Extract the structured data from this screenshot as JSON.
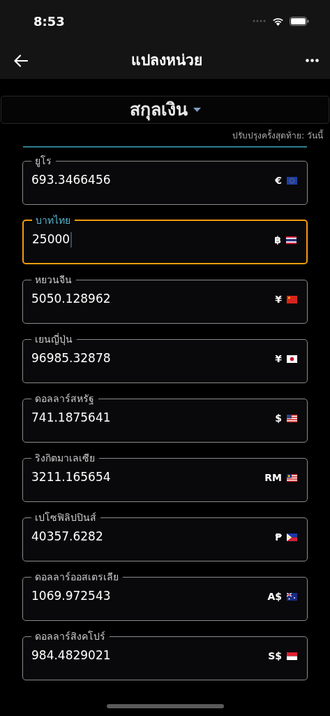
{
  "status_bar": {
    "time": "8:53"
  },
  "nav": {
    "title": "แปลงหน่วย"
  },
  "category": {
    "label": "สกุลเงิน"
  },
  "updated": "ปรับปรุงครั้งสุดท้าย: วันนี้",
  "fields": [
    {
      "label": "ยูโร",
      "value": "693.3466456",
      "symbol": "€",
      "focused": false
    },
    {
      "label": "บาทไทย",
      "value": "25000",
      "symbol": "฿",
      "focused": true
    },
    {
      "label": "หยวนจีน",
      "value": "5050.128962",
      "symbol": "¥",
      "focused": false
    },
    {
      "label": "เยนญี่ปุ่น",
      "value": "96985.32878",
      "symbol": "¥",
      "focused": false
    },
    {
      "label": "ดอลลาร์สหรัฐ",
      "value": "741.1875641",
      "symbol": "$",
      "focused": false
    },
    {
      "label": "ริงกิตมาเลเซีย",
      "value": "3211.165654",
      "symbol": "RM",
      "focused": false
    },
    {
      "label": "เปโซฟิลิปปินส์",
      "value": "40357.6282",
      "symbol": "₱",
      "focused": false
    },
    {
      "label": "ดอลลาร์ออสเตรเลีย",
      "value": "1069.972543",
      "symbol": "A$",
      "focused": false
    },
    {
      "label": "ดอลลาร์สิงคโปร์",
      "value": "984.4829021",
      "symbol": "S$",
      "focused": false
    }
  ]
}
